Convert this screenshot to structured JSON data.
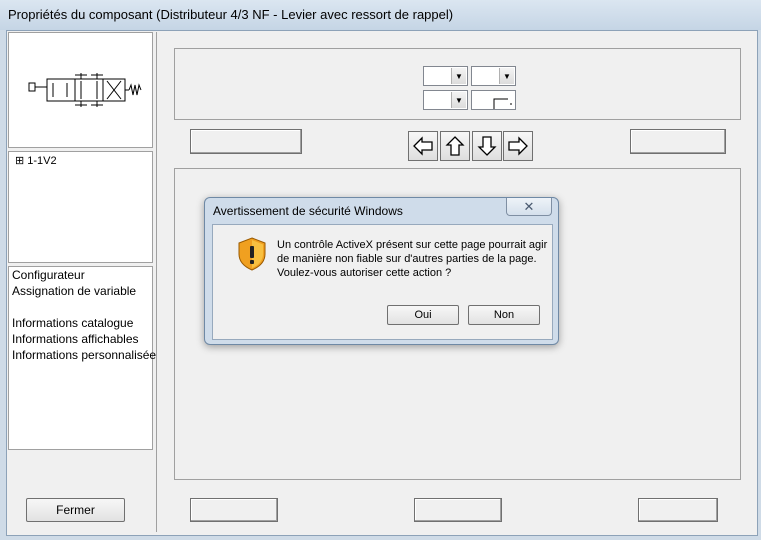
{
  "window": {
    "title": "Propriétés du composant (Distributeur 4/3 NF - Levier avec ressort de rappel)"
  },
  "tree": {
    "expander": "⊞",
    "node_label": "1-1V2"
  },
  "sidebar_menu": {
    "items": [
      "Configurateur",
      "Assignation de variable",
      "Informations catalogue",
      "Informations affichables",
      "Informations personnalisées"
    ]
  },
  "buttons": {
    "close_label": "Fermer"
  },
  "arrows": {
    "left": "left-arrow-icon",
    "up": "up-arrow-icon",
    "down": "down-arrow-icon",
    "right": "right-arrow-icon"
  },
  "dialog": {
    "title": "Avertissement de sécurité Windows",
    "close_glyph": "✕",
    "message_lines": [
      "Un contrôle ActiveX présent sur cette page pourrait agir",
      "de manière non fiable sur d'autres parties de la page.",
      "Voulez-vous autoriser cette action ?"
    ],
    "yes_label": "Oui",
    "no_label": "Non",
    "icon": "shield-warning-icon"
  },
  "colors": {
    "titlebar": "#c5d5e5",
    "dialog_frame": "#cfdcea",
    "shield_orange": "#f0a020"
  }
}
